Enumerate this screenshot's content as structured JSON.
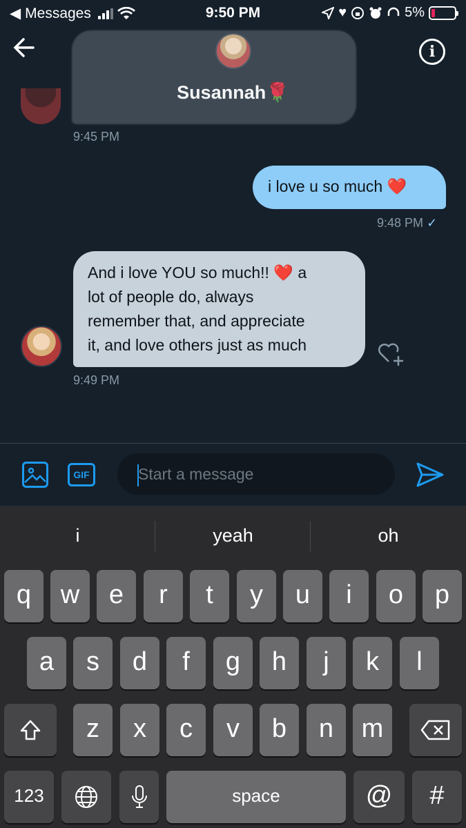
{
  "status_bar": {
    "back_app": "Messages",
    "time": "9:50 PM",
    "battery": "5%"
  },
  "header": {
    "contact_name": "Susannah",
    "contact_emoji": "🌹"
  },
  "messages": [
    {
      "direction": "incoming",
      "text": "",
      "timestamp": "9:45 PM"
    },
    {
      "direction": "outgoing",
      "text": "i love u so much ❤️",
      "timestamp": "9:48 PM",
      "status": "✓"
    },
    {
      "direction": "incoming",
      "lines": [
        "And i love YOU so much!! ❤️ a",
        "lot of people do, always",
        "remember that, and appreciate",
        "it, and love others just as much"
      ],
      "timestamp": "9:49 PM"
    }
  ],
  "composer": {
    "gif_label": "GIF",
    "placeholder": "Start a message"
  },
  "keyboard": {
    "suggestions": [
      "i",
      "yeah",
      "oh"
    ],
    "row1": [
      "q",
      "w",
      "e",
      "r",
      "t",
      "y",
      "u",
      "i",
      "o",
      "p"
    ],
    "row2": [
      "a",
      "s",
      "d",
      "f",
      "g",
      "h",
      "j",
      "k",
      "l"
    ],
    "row3": [
      "z",
      "x",
      "c",
      "v",
      "b",
      "n",
      "m"
    ],
    "numbers_label": "123",
    "space_label": "space",
    "at_label": "@",
    "hash_label": "#"
  },
  "colors": {
    "background": "#15202b",
    "accent": "#1d9bf0",
    "outgoing_bubble": "#8ecdf8",
    "incoming_bubble": "#c7d2db"
  }
}
